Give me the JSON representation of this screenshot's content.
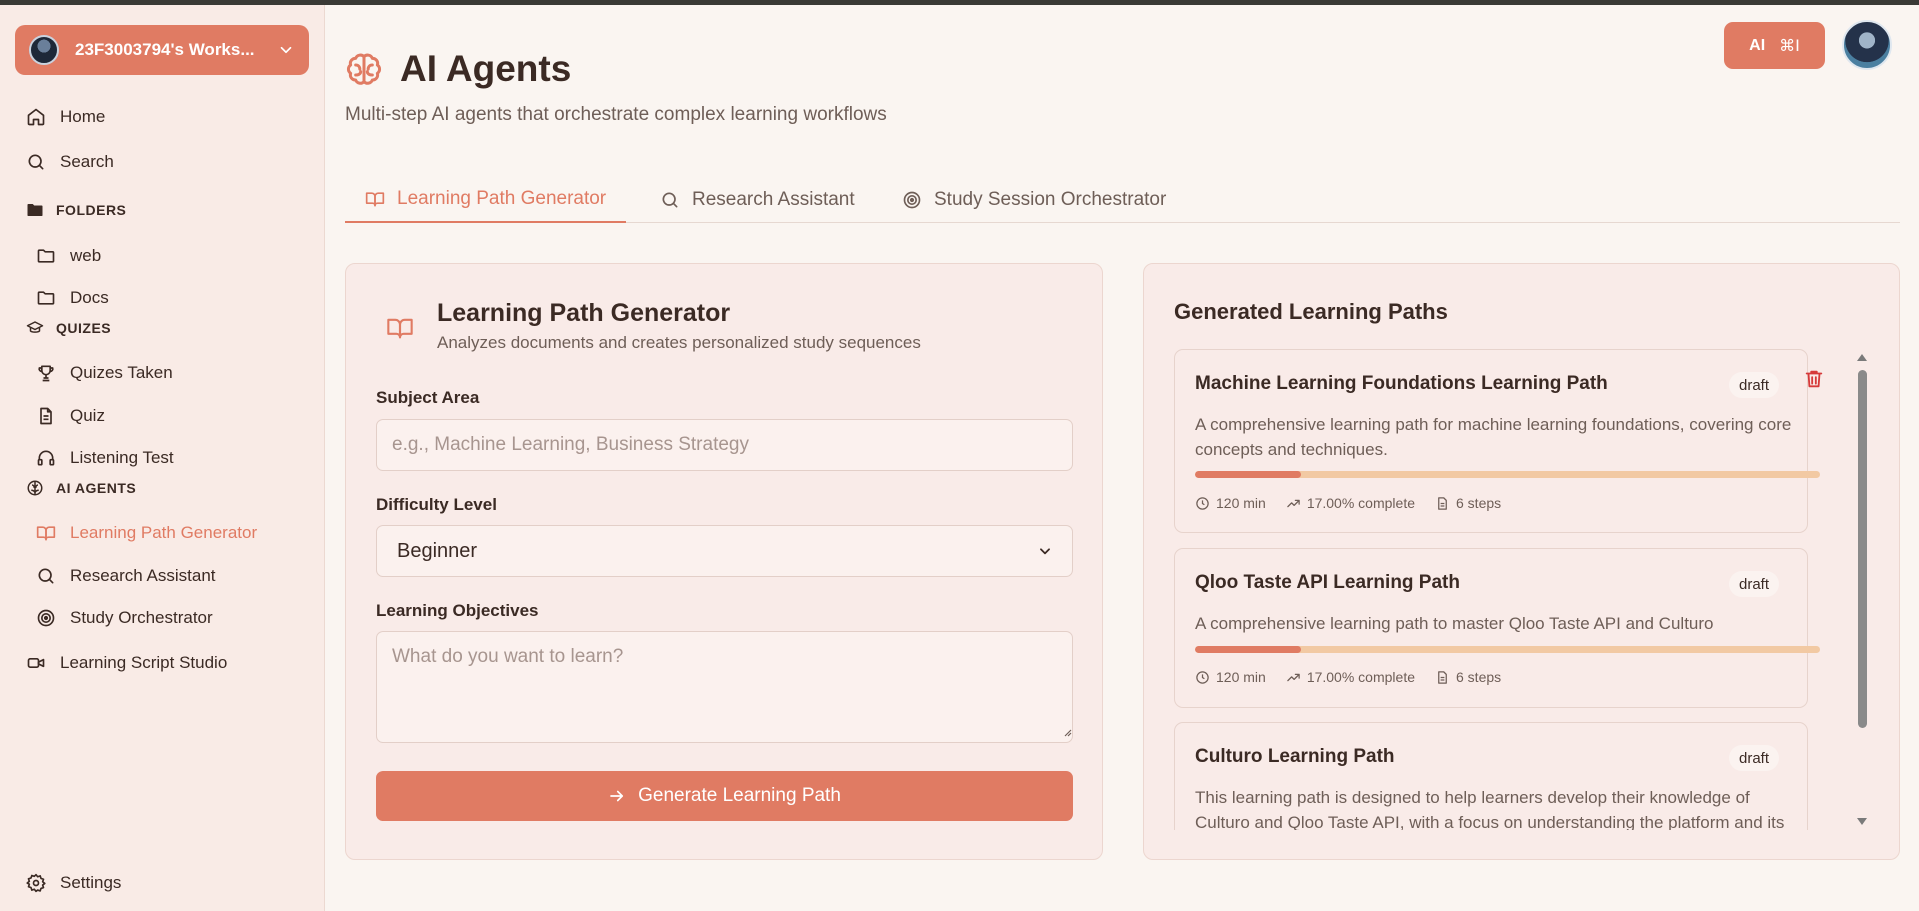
{
  "workspace": {
    "name": "23F3003794's Works..."
  },
  "sidebar": {
    "home": "Home",
    "search": "Search",
    "folders_title": "FOLDERS",
    "folders": [
      "web",
      "Docs"
    ],
    "quizzes_title": "QUIZES",
    "quizzes": [
      "Quizes Taken",
      "Quiz",
      "Listening Test"
    ],
    "agents_title": "AI AGENTS",
    "agents": [
      "Learning Path Generator",
      "Research Assistant",
      "Study Orchestrator"
    ],
    "script_studio": "Learning Script Studio",
    "settings": "Settings"
  },
  "header": {
    "title": "AI Agents",
    "subtitle": "Multi-step AI agents that orchestrate complex learning workflows",
    "ai_button": "AI",
    "ai_shortcut": "⌘I"
  },
  "tabs": [
    {
      "label": "Learning Path Generator",
      "active": true
    },
    {
      "label": "Research Assistant",
      "active": false
    },
    {
      "label": "Study Session Orchestrator",
      "active": false
    }
  ],
  "generator": {
    "title": "Learning Path Generator",
    "subtitle": "Analyzes documents and creates personalized study sequences",
    "subject_label": "Subject Area",
    "subject_placeholder": "e.g., Machine Learning, Business Strategy",
    "difficulty_label": "Difficulty Level",
    "difficulty_value": "Beginner",
    "objectives_label": "Learning Objectives",
    "objectives_placeholder": "What do you want to learn?",
    "button": "Generate Learning Path"
  },
  "paths": {
    "title": "Generated Learning Paths",
    "items": [
      {
        "title": "Machine Learning Foundations Learning Path",
        "status": "draft",
        "description": "A comprehensive learning path for machine learning foundations, covering core concepts and techniques.",
        "progress": 0.17,
        "duration": "120 min",
        "complete": "17.00% complete",
        "steps": "6 steps"
      },
      {
        "title": "Qloo Taste API Learning Path",
        "status": "draft",
        "description": "A comprehensive learning path to master Qloo Taste API and Culturo",
        "progress": 0.17,
        "duration": "120 min",
        "complete": "17.00% complete",
        "steps": "6 steps"
      },
      {
        "title": "Culturo Learning Path",
        "status": "draft",
        "description": "This learning path is designed to help learners develop their knowledge of Culturo and Qloo Taste API, with a focus on understanding the platform and its"
      }
    ]
  },
  "colors": {
    "accent": "#e07b63",
    "sidebar_bg": "#f9ebe6",
    "page_bg": "#faf5f1",
    "progress_track": "#f2c9a3"
  }
}
